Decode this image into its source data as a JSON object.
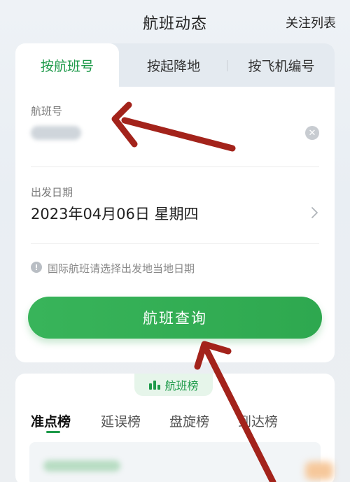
{
  "header": {
    "title": "航班动态",
    "follow_link": "关注列表"
  },
  "search": {
    "tabs": [
      {
        "label": "按航班号",
        "active": true
      },
      {
        "label": "按起降地",
        "active": false
      },
      {
        "label": "按飞机编号",
        "active": false
      }
    ],
    "flight_field": {
      "label": "航班号",
      "value": ""
    },
    "date_field": {
      "label": "出发日期",
      "value": "2023年04月06日  星期四"
    },
    "tip": "国际航班请选择出发地当地日期",
    "query_button": "航班查询"
  },
  "ranking": {
    "title": "航班榜",
    "tabs": [
      {
        "label": "准点榜",
        "active": true
      },
      {
        "label": "延误榜",
        "active": false
      },
      {
        "label": "盘旋榜",
        "active": false
      },
      {
        "label": "到达榜",
        "active": false
      }
    ]
  },
  "colors": {
    "accent": "#1e9a4a",
    "button": "#2ea84f",
    "annotation_arrow": "#a3231b"
  },
  "icons": {
    "clear": "clear-icon",
    "chevron": "chevron-right-icon",
    "info": "info-icon",
    "ranking": "ranking-icon"
  }
}
